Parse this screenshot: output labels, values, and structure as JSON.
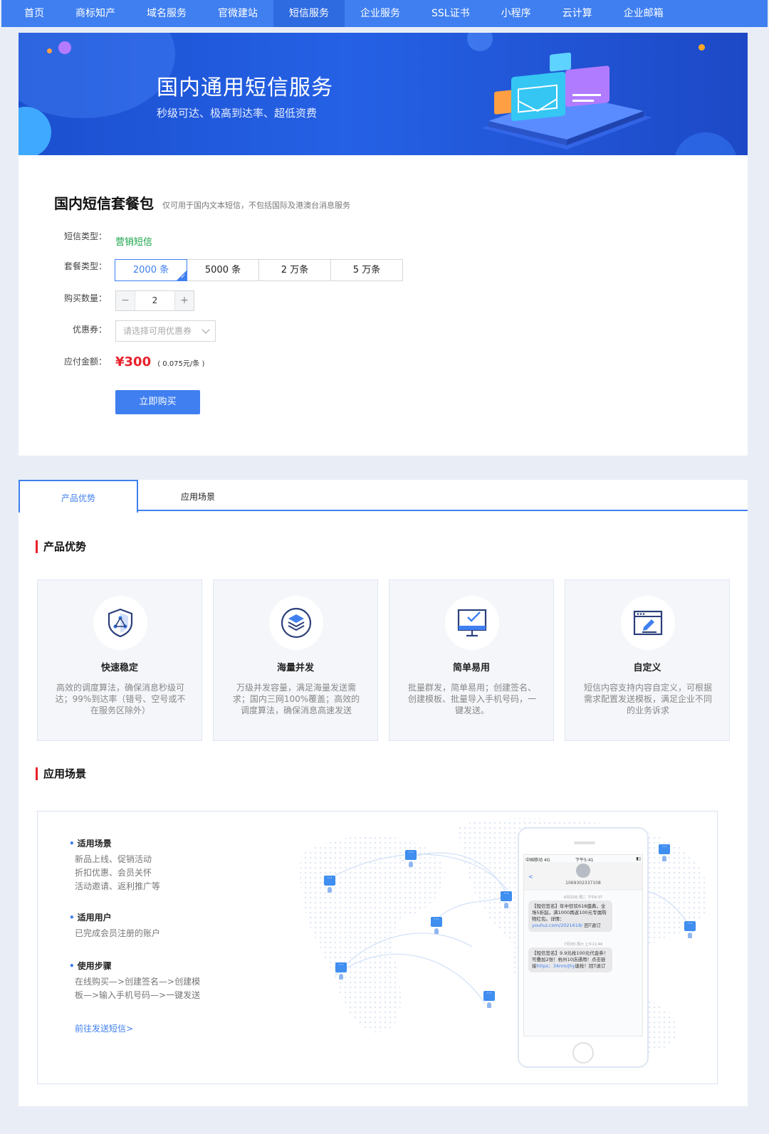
{
  "nav": {
    "items": [
      "首页",
      "商标知产",
      "域名服务",
      "官微建站",
      "短信服务",
      "企业服务",
      "SSL证书",
      "小程序",
      "云计算",
      "企业邮箱"
    ],
    "active_index": 4,
    "color": "#3f7ff0"
  },
  "banner": {
    "title": "国内通用短信服务",
    "subtitle": "秒级可达、极高到达率、超低资费"
  },
  "package": {
    "title": "国内短信套餐包",
    "note": "仅可用于国内文本短信，不包括国际及港澳台消息服务",
    "sms_type_label": "短信类型：",
    "sms_type_value": "营销短信",
    "pkg_label": "套餐类型：",
    "pkg_options": [
      "2000 条",
      "5000 条",
      "2 万条",
      "5 万条"
    ],
    "pkg_selected": 0,
    "qty_label": "购买数量：",
    "qty_minus": "−",
    "qty_value": "2",
    "qty_plus": "+",
    "coupon_label": "优惠券：",
    "coupon_placeholder": "请选择可用优惠券",
    "price_label": "应付金额：",
    "price_amount": "¥300",
    "price_unit": "( 0.075元/条 )",
    "buy_button": "立即购买",
    "price_color": "#e8222c"
  },
  "tabs": {
    "items": [
      "产品优势",
      "应用场景"
    ],
    "active_index": 0
  },
  "advantages": {
    "title": "产品优势",
    "cards": [
      {
        "title": "快速稳定",
        "desc": "高效的调度算法，确保消息秒级可达；99%到达率（错号、空号或不在服务区除外）",
        "icon": "shield-network-icon"
      },
      {
        "title": "海量并发",
        "desc": "万级并发容量，满足海量发送需求；国内三网100%覆盖；高效的调度算法，确保消息高速发送",
        "icon": "layers-icon"
      },
      {
        "title": "简单易用",
        "desc": "批量群发，简单易用；创建签名、创建模板、批量导入手机号码，一键发送。",
        "icon": "monitor-check-icon"
      },
      {
        "title": "自定义",
        "desc": "短信内容支持内容自定义，可根据需求配置发送模板，满足企业不同的业务诉求",
        "icon": "edit-window-icon"
      }
    ]
  },
  "scenes": {
    "title": "应用场景",
    "blocks": [
      {
        "heading": "适用场景",
        "lines": [
          "新品上线、促销活动",
          "折扣优惠、会员关怀",
          "活动邀请、返利推广等"
        ]
      },
      {
        "heading": "适用用户",
        "lines": [
          "已完成会员注册的账户"
        ]
      },
      {
        "heading": "使用步骤",
        "lines": [
          "在线购买—>创建签名—>创建模",
          "板—>输入手机号码—>一键发送"
        ]
      }
    ],
    "link": "前往发送短信>",
    "phone": {
      "carrier": "中国移动 4G",
      "time": "下午5:41",
      "number": "1069302337108",
      "back": "<",
      "date1": "6月22日 周二 下午6:37",
      "msg1_a": "【短信签名】年中狂欢618盛典，全场5折起，满1000再返100元专属购物红包。详情：",
      "msg1_link": "youhui.com/2021618/",
      "msg1_b": " 回T退订",
      "date2": "7月3日 周六 上午11:44",
      "msg2_a": "【短信签名】9.9元抢100元代金券！可叠加2张！杭州10店通用！点击链接",
      "msg2_link": "https：34nm/jhy",
      "msg2_b": "速抢！回T退订"
    }
  }
}
